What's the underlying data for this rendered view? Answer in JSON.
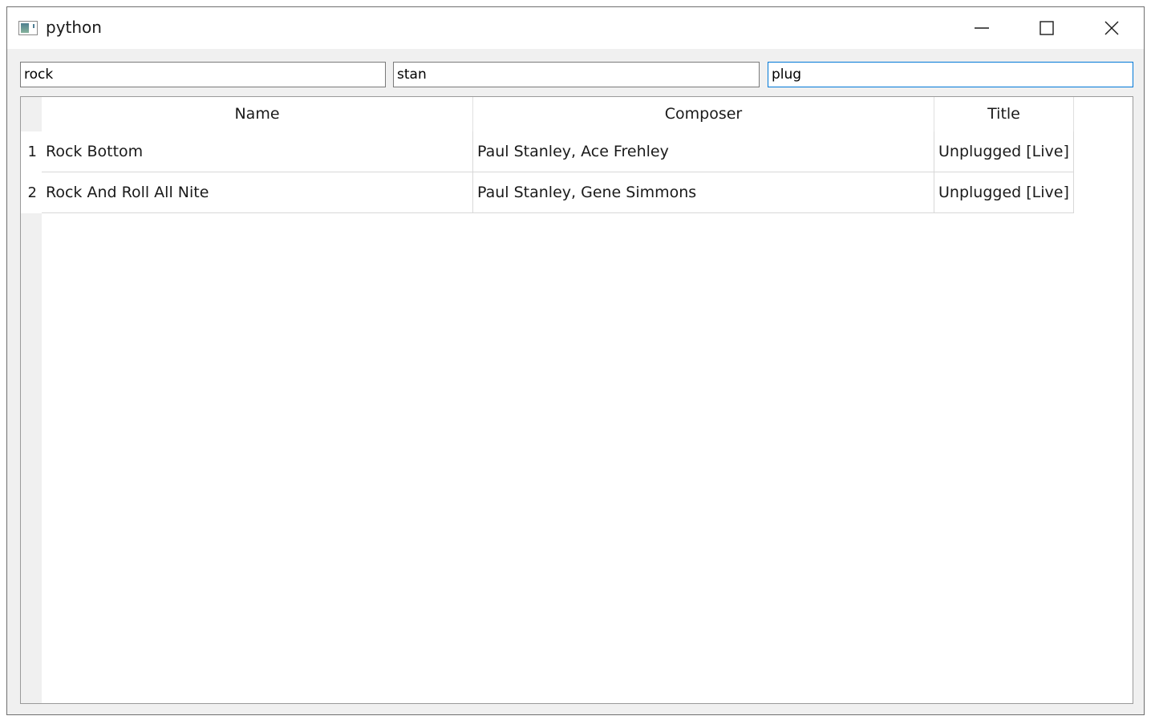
{
  "window": {
    "title": "python"
  },
  "filters": [
    {
      "value": "rock"
    },
    {
      "value": "stan"
    },
    {
      "value": "plug"
    }
  ],
  "table": {
    "columns": [
      "Name",
      "Composer",
      "Title"
    ],
    "rows": [
      {
        "index": "1",
        "name": "Rock Bottom",
        "composer": "Paul Stanley, Ace Frehley",
        "title": "Unplugged [Live]"
      },
      {
        "index": "2",
        "name": "Rock And Roll All Nite",
        "composer": "Paul Stanley, Gene Simmons",
        "title": "Unplugged [Live]"
      }
    ]
  }
}
